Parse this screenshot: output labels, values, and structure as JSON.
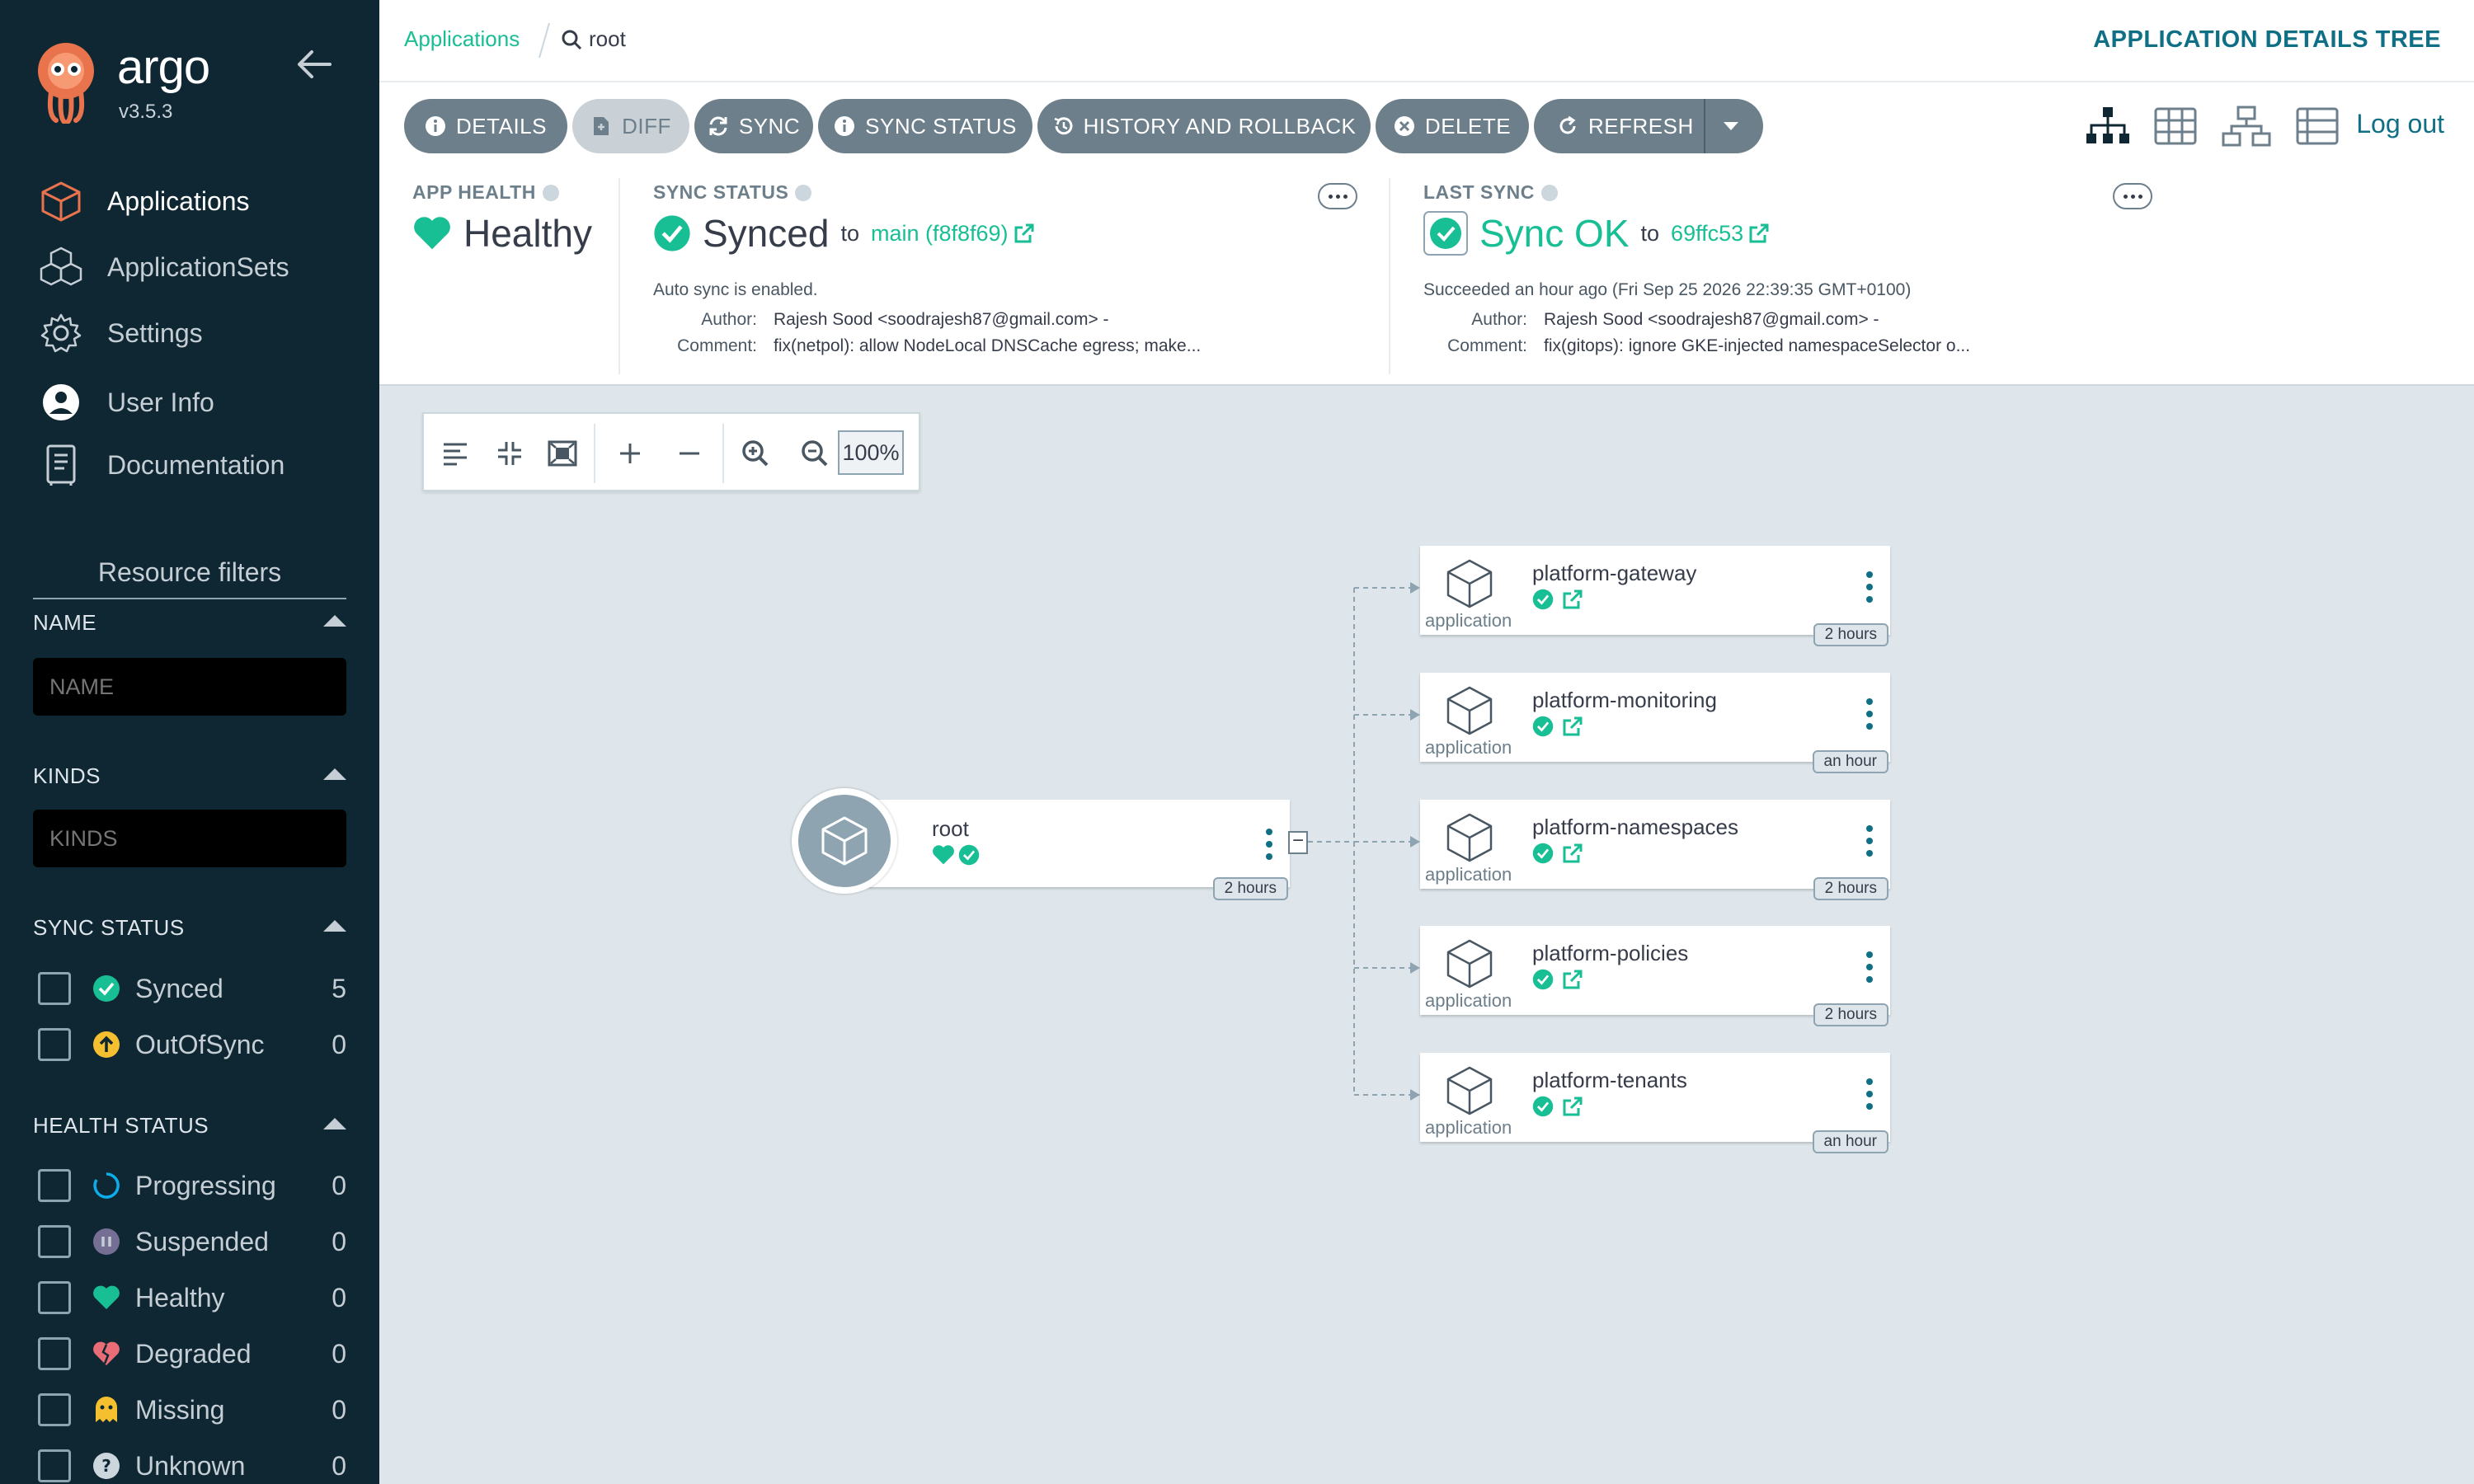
{
  "sidebar": {
    "logo_text": "argo",
    "version": "v3.5.3",
    "nav": [
      {
        "label": "Applications",
        "icon": "cube-icon",
        "active": true
      },
      {
        "label": "ApplicationSets",
        "icon": "cubes-icon"
      },
      {
        "label": "Settings",
        "icon": "gear-icon"
      },
      {
        "label": "User Info",
        "icon": "user-circle-icon"
      },
      {
        "label": "Documentation",
        "icon": "book-icon"
      }
    ],
    "resource_filters_title": "Resource filters",
    "name_filter": {
      "heading": "NAME",
      "placeholder": "NAME"
    },
    "kinds_filter": {
      "heading": "KINDS",
      "placeholder": "KINDS"
    },
    "sync_status": {
      "heading": "SYNC STATUS",
      "items": [
        {
          "label": "Synced",
          "count": "5",
          "icon": "check-circle-icon",
          "color": "#18be94"
        },
        {
          "label": "OutOfSync",
          "count": "0",
          "icon": "arrow-up-circle-icon",
          "color": "#f4c030"
        }
      ]
    },
    "health_status": {
      "heading": "HEALTH STATUS",
      "items": [
        {
          "label": "Progressing",
          "count": "0",
          "icon": "progress-ring-icon",
          "color": "#0dadea"
        },
        {
          "label": "Suspended",
          "count": "0",
          "icon": "pause-circle-icon",
          "color": "#766f94"
        },
        {
          "label": "Healthy",
          "count": "0",
          "icon": "heart-icon",
          "color": "#18be94"
        },
        {
          "label": "Degraded",
          "count": "0",
          "icon": "broken-heart-icon",
          "color": "#e96d76"
        },
        {
          "label": "Missing",
          "count": "0",
          "icon": "ghost-icon",
          "color": "#f4c030"
        },
        {
          "label": "Unknown",
          "count": "0",
          "icon": "question-circle-icon",
          "color": "#ccd6dd"
        }
      ]
    }
  },
  "topbar": {
    "breadcrumb_link": "Applications",
    "breadcrumb_current": "root",
    "title": "APPLICATION DETAILS TREE"
  },
  "toolbar": {
    "buttons": [
      {
        "label": "DETAILS",
        "icon": "info-icon"
      },
      {
        "label": "DIFF",
        "icon": "file-diff-icon",
        "disabled": true
      },
      {
        "label": "SYNC",
        "icon": "sync-icon"
      },
      {
        "label": "SYNC STATUS",
        "icon": "info-icon"
      },
      {
        "label": "HISTORY AND ROLLBACK",
        "icon": "history-icon"
      },
      {
        "label": "DELETE",
        "icon": "times-circle-icon"
      },
      {
        "label": "REFRESH",
        "icon": "redo-icon"
      }
    ],
    "logout": "Log out"
  },
  "status": {
    "app_health": {
      "label": "APP HEALTH",
      "value": "Healthy"
    },
    "sync_status": {
      "label": "SYNC STATUS",
      "value": "Synced",
      "to": "to",
      "revision": "main (f8f8f69)",
      "auto_sync": "Auto sync is enabled.",
      "author_label": "Author:",
      "author": "Rajesh Sood <soodrajesh87@gmail.com> -",
      "comment_label": "Comment:",
      "comment": "fix(netpol): allow NodeLocal DNSCache egress; make..."
    },
    "last_sync": {
      "label": "LAST SYNC",
      "value": "Sync OK",
      "to": "to",
      "revision": "69ffc53",
      "succeeded": "Succeeded an hour ago (Fri Sep 25 2026 22:39:35 GMT+0100)",
      "author_label": "Author:",
      "author": "Rajesh Sood <soodrajesh87@gmail.com> -",
      "comment_label": "Comment:",
      "comment": "fix(gitops): ignore GKE-injected namespaceSelector o..."
    }
  },
  "graph": {
    "zoom": "100%",
    "root": {
      "name": "root",
      "age": "2 hours"
    },
    "children": [
      {
        "name": "platform-gateway",
        "kind": "application",
        "age": "2 hours"
      },
      {
        "name": "platform-monitoring",
        "kind": "application",
        "age": "an hour"
      },
      {
        "name": "platform-namespaces",
        "kind": "application",
        "age": "2 hours"
      },
      {
        "name": "platform-policies",
        "kind": "application",
        "age": "2 hours"
      },
      {
        "name": "platform-tenants",
        "kind": "application",
        "age": "an hour"
      }
    ]
  },
  "colors": {
    "accent": "#18be94",
    "sidebar_bg": "#0f2733",
    "button_gray": "#6d7f8b",
    "title_teal": "#0e6f85"
  }
}
